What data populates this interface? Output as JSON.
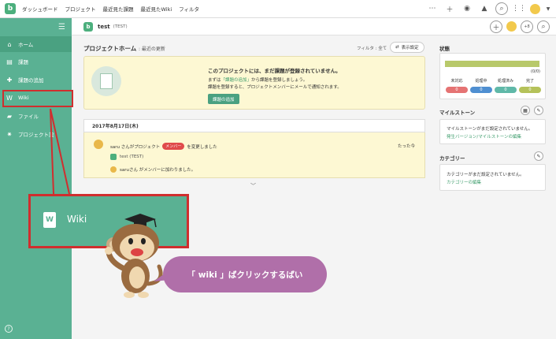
{
  "topbar": {
    "logo": "b",
    "nav": [
      "ダッシュボード",
      "プロジェクト",
      "最近見た課題",
      "最近見たWiki",
      "フィルタ"
    ],
    "icons": [
      "more-icon",
      "plus-icon",
      "eye-icon",
      "bell-icon",
      "search-icon",
      "apps-icon",
      "avatar",
      "chevron-down-icon"
    ]
  },
  "sidebar": {
    "items": [
      {
        "label": "ホーム",
        "icon": "home-icon"
      },
      {
        "label": "課題",
        "icon": "list-icon"
      },
      {
        "label": "課題の追加",
        "icon": "plus-icon"
      },
      {
        "label": "Wiki",
        "icon": "wiki-icon"
      },
      {
        "label": "ファイル",
        "icon": "folder-icon"
      },
      {
        "label": "プロジェクト設",
        "icon": "gear-icon"
      }
    ],
    "help": "?"
  },
  "project": {
    "logo": "b",
    "name": "test",
    "key": "(TEST)",
    "member_count": "+8"
  },
  "main": {
    "title": "プロジェクトホーム",
    "subtitle": ": 最近の更新",
    "filter": "フィルタ : 全て",
    "display_settings": "表示設定",
    "notice": {
      "title": "このプロジェクトには、まだ課題が登録されていません。",
      "line1_pre": "まずは",
      "line1_link": "「課題の追加」",
      "line1_post": "から課題を登録しましょう。",
      "line2": "課題を登録すると、プロジェクトメンバーにメールで通知されます。",
      "button": "課題の追加"
    },
    "date": "2017年8月17日(木)",
    "activity": {
      "pre": "saru さんがプロジェクト",
      "badge": "メンバー",
      "post": "を変更しました",
      "time": "たった今",
      "project": "test (TEST)",
      "message": "saruさん がメンバーに加わりました。"
    }
  },
  "right": {
    "status_title": "状態",
    "status_count": "(0/0)",
    "status_cols": [
      {
        "label": "未対応",
        "value": "0",
        "color": "#e57373"
      },
      {
        "label": "処理中",
        "value": "0",
        "color": "#4f8fd1"
      },
      {
        "label": "処理済み",
        "value": "0",
        "color": "#5fb8a8"
      },
      {
        "label": "完了",
        "value": "0",
        "color": "#b5c25a"
      }
    ],
    "milestone_title": "マイルストーン",
    "milestone_text": "マイルストーンがまだ設定されていません。",
    "milestone_link": "発生バージョン/マイルストーンの編集",
    "category_title": "カテゴリー",
    "category_text": "カテゴリーがまだ設定されていません。",
    "category_link": "カテゴリーの編集"
  },
  "overlay": {
    "zoom_label": "Wiki",
    "zoom_icon": "W",
    "speech": "「 wiki 」ばクリックするばい"
  }
}
